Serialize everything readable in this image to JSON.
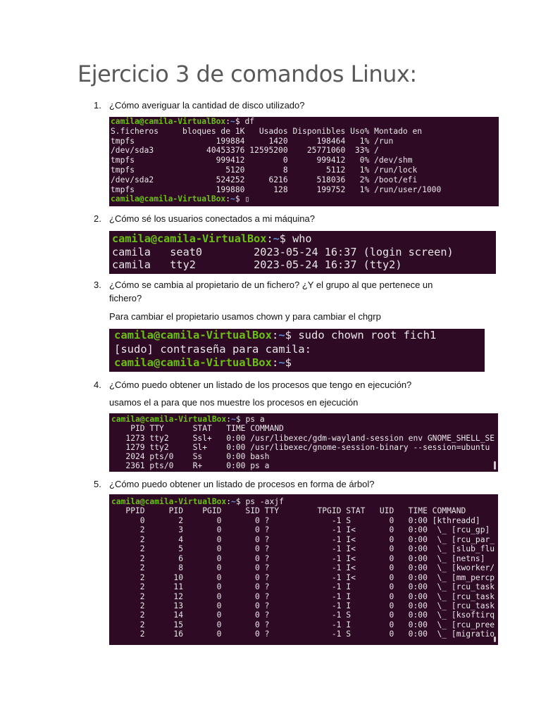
{
  "title": "Ejercicio 3 de comandos Linux:",
  "prompt": {
    "user": "camila@camila-VirtualBox",
    "sep": ":",
    "dir": "~",
    "sign": "$ "
  },
  "questions": [
    {
      "n": "1.",
      "text": "¿Cómo averiguar la cantidad de disco utilizado?"
    },
    {
      "n": "2.",
      "text": "¿Cómo sé los usuarios conectados a mi máquina?"
    },
    {
      "n": "3.",
      "text": "¿Cómo se cambia al propietario de un fichero? ¿Y el grupo al que pertenece un fichero?"
    },
    {
      "n": "4.",
      "text": "¿Cómo puedo obtener un listado de los procesos que tengo en ejecución?"
    },
    {
      "n": "5.",
      "text": "¿Cómo puedo obtener un listado de procesos en forma de árbol?"
    }
  ],
  "answers": {
    "q3": "Para cambiar el propietario usamos chown y para cambiar el chgrp",
    "q4": "usamos el a para que nos muestre los procesos en ejecución"
  },
  "terminals": [
    {
      "lines": [
        {
          "cmd": "df"
        },
        "S.ficheros     bloques de 1K   Usados Disponibles Uso% Montado en",
        "tmpfs                 199884     1420      198464   1% /run",
        "/dev/sda3           40453376 12595200    25771060  33% /",
        "tmpfs                 999412        0      999412   0% /dev/shm",
        "tmpfs                   5120        8        5112   1% /run/lock",
        "/dev/sda2             524252     6216      518036   2% /boot/efi",
        "tmpfs                 199880      128      199752   1% /run/user/1000",
        {
          "cmd": "▯"
        }
      ]
    },
    {
      "lines": [
        {
          "cmd": "who"
        },
        "camila   seat0        2023-05-24 16:37 (login screen)",
        "camila   tty2         2023-05-24 16:37 (tty2)"
      ]
    },
    {
      "lines": [
        {
          "cmd": "sudo chown root fich1"
        },
        "[sudo] contraseña para camila:",
        {
          "cmd": ""
        }
      ]
    },
    {
      "lines": [
        {
          "cmd": "ps a"
        },
        "    PID TTY      STAT   TIME COMMAND",
        "   1273 tty2     Ssl+   0:00 /usr/libexec/gdm-wayland-session env GNOME_SHELL_SE",
        "   1279 tty2     Sl+    0:00 /usr/libexec/gnome-session-binary --session=ubuntu",
        "   2024 pts/0    Ss     0:00 bash",
        "   2361 pts/0    R+     0:00 ps a"
      ]
    },
    {
      "lines": [
        {
          "cmd": "ps -axjf"
        },
        "   PPID     PID    PGID     SID TTY        TPGID STAT   UID   TIME COMMAND",
        "      0       2       0       0 ?             -1 S        0   0:00 [kthreadd]",
        "      2       3       0       0 ?             -1 I<       0   0:00  \\_ [rcu_gp]",
        "      2       4       0       0 ?             -1 I<       0   0:00  \\_ [rcu_par_",
        "      2       5       0       0 ?             -1 I<       0   0:00  \\_ [slub_flu",
        "      2       6       0       0 ?             -1 I<       0   0:00  \\_ [netns]",
        "      2       8       0       0 ?             -1 I<       0   0:00  \\_ [kworker/",
        "      2      10       0       0 ?             -1 I<       0   0:00  \\_ [mm_percp",
        "      2      11       0       0 ?             -1 I        0   0:00  \\_ [rcu_task",
        "      2      12       0       0 ?             -1 I        0   0:00  \\_ [rcu_task",
        "      2      13       0       0 ?             -1 I        0   0:00  \\_ [rcu_task",
        "      2      14       0       0 ?             -1 S        0   0:00  \\_ [ksoftirq",
        "      2      15       0       0 ?             -1 I        0   0:00  \\_ [rcu_pree",
        "      2      16       0       0 ?             -1 S        0   0:00  \\_ [migratio"
      ]
    }
  ]
}
